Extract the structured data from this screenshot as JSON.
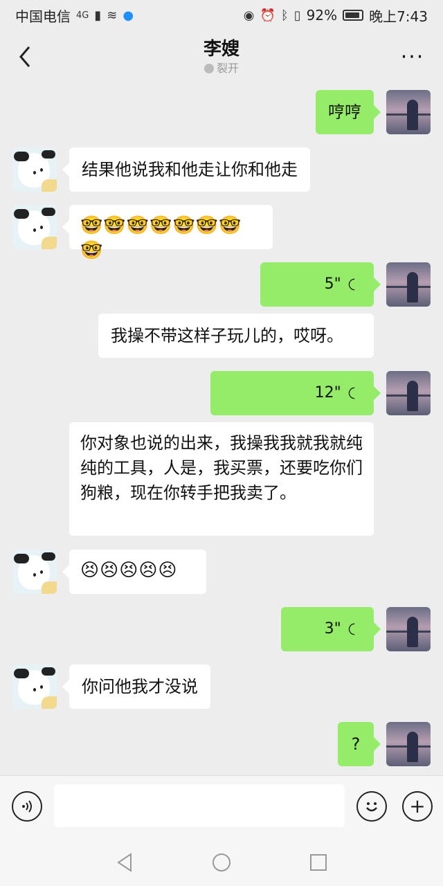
{
  "status": {
    "carrier": "中国电信",
    "network": "4G",
    "battery": "92%",
    "battery_level": 0.92,
    "time": "晚上7:43"
  },
  "header": {
    "title": "李嫂",
    "subtitle": "裂开"
  },
  "messages": [
    {
      "side": "me",
      "type": "text",
      "text": "哼哼"
    },
    {
      "side": "them",
      "type": "text",
      "text": "结果他说我和他走让你和他走"
    },
    {
      "side": "them",
      "type": "emoji",
      "text": "🤓🤓🤓🤓🤓🤓🤓🤓"
    },
    {
      "side": "me",
      "type": "voice",
      "text": "5\""
    },
    {
      "side": "me",
      "type": "text",
      "text": "我操不带这样子玩儿的，哎呀。"
    },
    {
      "side": "me",
      "type": "voice",
      "text": "12\""
    },
    {
      "side": "me",
      "type": "text",
      "text": "你对象也说的出来，我操我我就我就纯纯的工具，人是，我买票，还要吃你们狗粮，现在你转手把我卖了。"
    },
    {
      "side": "them",
      "type": "emoji",
      "text": "😣😣😣😣😣"
    },
    {
      "side": "me",
      "type": "voice",
      "text": "3\""
    },
    {
      "side": "them",
      "type": "text",
      "text": "你问他我才没说"
    },
    {
      "side": "me",
      "type": "text",
      "text": "?"
    }
  ],
  "input": {
    "placeholder": ""
  },
  "icons": {
    "back": "chevron-left-icon",
    "more": "more-dots-icon",
    "voice_toggle": "voice-icon",
    "emoji": "emoji-icon",
    "plus": "plus-icon"
  }
}
